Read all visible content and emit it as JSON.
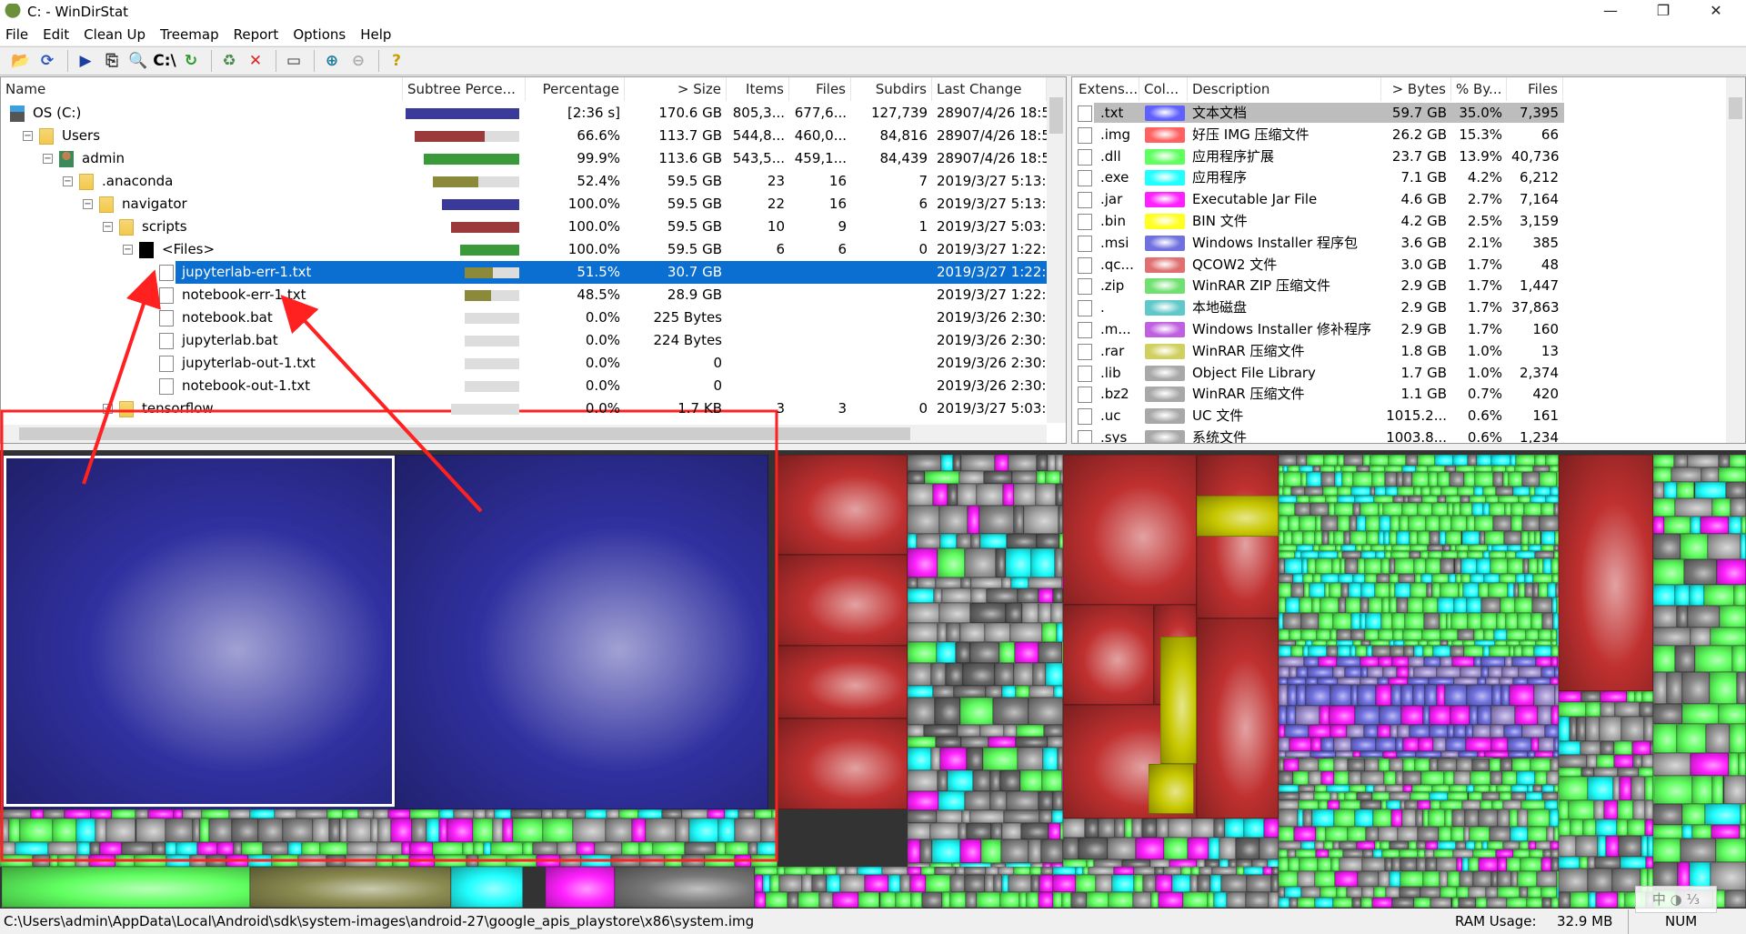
{
  "window": {
    "title": "C: - WinDirStat",
    "minimize": "—",
    "restore": "❐",
    "close": "✕"
  },
  "menu": [
    "File",
    "Edit",
    "Clean Up",
    "Treemap",
    "Report",
    "Options",
    "Help"
  ],
  "toolbar": [
    {
      "icon": "open-folder-icon",
      "glyph": "📂",
      "color": "#c89a1a"
    },
    {
      "icon": "refresh-all-icon",
      "glyph": "⟳",
      "color": "#2a55c0"
    },
    {
      "sep": true
    },
    {
      "icon": "play-icon",
      "glyph": "▶",
      "color": "#1b3fa0"
    },
    {
      "icon": "copy-path-icon",
      "glyph": "⎘",
      "color": "#333"
    },
    {
      "icon": "explorer-icon",
      "glyph": "🔍",
      "color": "#333"
    },
    {
      "icon": "command-prompt-icon",
      "glyph": "C:\\",
      "color": "#000"
    },
    {
      "icon": "refresh-selected-icon",
      "glyph": "↻",
      "color": "#2a9a2a"
    },
    {
      "sep": true
    },
    {
      "icon": "recycle-bin-icon",
      "glyph": "♻",
      "color": "#4a8a4a"
    },
    {
      "icon": "delete-icon",
      "glyph": "✕",
      "color": "#e02020"
    },
    {
      "sep": true
    },
    {
      "icon": "properties-icon",
      "glyph": "▭",
      "color": "#333"
    },
    {
      "sep": true
    },
    {
      "icon": "zoom-in-icon",
      "glyph": "⊕",
      "color": "#1a7a9a"
    },
    {
      "icon": "zoom-out-icon",
      "glyph": "⊖",
      "color": "#aaa"
    },
    {
      "sep": true
    },
    {
      "icon": "help-icon",
      "glyph": "?",
      "color": "#c8a000"
    }
  ],
  "tree": {
    "columns": [
      "Name",
      "Subtree Perce...",
      "Percentage",
      "> Size",
      "Items",
      "Files",
      "Subdirs",
      "Last Change"
    ],
    "rows": [
      {
        "name": "OS (C:)",
        "depth": 0,
        "icon": "drive",
        "expander": "",
        "fill": 1.0,
        "color": "#3a3a9a",
        "pct": "[2:36 s]",
        "size": "170.6 GB",
        "items": "805,3...",
        "files": "677,6...",
        "subdirs": "127,739",
        "changed": "28907/4/26  18:5"
      },
      {
        "name": "Users",
        "depth": 1,
        "icon": "folder",
        "expander": "−",
        "fill": 0.666,
        "color": "#9a3a3a",
        "pct": "66.6%",
        "size": "113.7 GB",
        "items": "544,8...",
        "files": "460,0...",
        "subdirs": "84,816",
        "changed": "28907/4/26  18:5"
      },
      {
        "name": "admin",
        "depth": 2,
        "icon": "user",
        "expander": "−",
        "fill": 0.999,
        "color": "#3a9a3a",
        "pct": "99.9%",
        "size": "113.6 GB",
        "items": "543,5...",
        "files": "459,1...",
        "subdirs": "84,439",
        "changed": "28907/4/26  18:5"
      },
      {
        "name": ".anaconda",
        "depth": 3,
        "icon": "folder",
        "expander": "−",
        "fill": 0.524,
        "color": "#8a8a3a",
        "pct": "52.4%",
        "size": "59.5 GB",
        "items": "23",
        "files": "16",
        "subdirs": "7",
        "changed": "2019/3/27  5:13:4"
      },
      {
        "name": "navigator",
        "depth": 4,
        "icon": "folder",
        "expander": "−",
        "fill": 1.0,
        "color": "#3a3a9a",
        "pct": "100.0%",
        "size": "59.5 GB",
        "items": "22",
        "files": "16",
        "subdirs": "6",
        "changed": "2019/3/27  5:13:4"
      },
      {
        "name": "scripts",
        "depth": 5,
        "icon": "folder",
        "expander": "−",
        "fill": 1.0,
        "color": "#9a3a3a",
        "pct": "100.0%",
        "size": "59.5 GB",
        "items": "10",
        "files": "9",
        "subdirs": "1",
        "changed": "2019/3/27  5:03:3"
      },
      {
        "name": "<Files>",
        "depth": 6,
        "icon": "files",
        "expander": "−",
        "fill": 1.0,
        "color": "#3a9a3a",
        "pct": "100.0%",
        "size": "59.5 GB",
        "items": "6",
        "files": "6",
        "subdirs": "0",
        "changed": "2019/3/27  1:22:5"
      },
      {
        "name": "jupyterlab-err-1.txt",
        "depth": 7,
        "icon": "file",
        "expander": "",
        "fill": 0.515,
        "color": "#8a8a3a",
        "pct": "51.5%",
        "size": "30.7 GB",
        "items": "",
        "files": "",
        "subdirs": "",
        "changed": "2019/3/27  1:22:5",
        "selected": true
      },
      {
        "name": "notebook-err-1.txt",
        "depth": 7,
        "icon": "file",
        "expander": "",
        "fill": 0.485,
        "color": "#8a8a3a",
        "pct": "48.5%",
        "size": "28.9 GB",
        "items": "",
        "files": "",
        "subdirs": "",
        "changed": "2019/3/27  1:22:5"
      },
      {
        "name": "notebook.bat",
        "depth": 7,
        "icon": "bat",
        "expander": "",
        "fill": 0,
        "color": "#8a8a3a",
        "pct": "0.0%",
        "size": "225 Bytes",
        "items": "",
        "files": "",
        "subdirs": "",
        "changed": "2019/3/26  2:30:4"
      },
      {
        "name": "jupyterlab.bat",
        "depth": 7,
        "icon": "bat",
        "expander": "",
        "fill": 0,
        "color": "#8a8a3a",
        "pct": "0.0%",
        "size": "224 Bytes",
        "items": "",
        "files": "",
        "subdirs": "",
        "changed": "2019/3/26  2:30:3"
      },
      {
        "name": "jupyterlab-out-1.txt",
        "depth": 7,
        "icon": "file",
        "expander": "",
        "fill": 0,
        "color": "#8a8a3a",
        "pct": "0.0%",
        "size": "0",
        "items": "",
        "files": "",
        "subdirs": "",
        "changed": "2019/3/26  2:30:3"
      },
      {
        "name": "notebook-out-1.txt",
        "depth": 7,
        "icon": "file",
        "expander": "",
        "fill": 0,
        "color": "#8a8a3a",
        "pct": "0.0%",
        "size": "0",
        "items": "",
        "files": "",
        "subdirs": "",
        "changed": "2019/3/26  2:30:4"
      },
      {
        "name": "tensorflow",
        "depth": 5,
        "icon": "folder",
        "expander": "+",
        "fill": 0,
        "color": "#9a3a3a",
        "pct": "0.0%",
        "size": "1.7 KB",
        "items": "3",
        "files": "3",
        "subdirs": "0",
        "changed": "2019/3/27  5:03:3"
      }
    ]
  },
  "extensions": {
    "columns": [
      "Extens...",
      "Col...",
      "Description",
      "> Bytes",
      "% By...",
      "Files"
    ],
    "rows": [
      {
        "ext": ".txt",
        "color": "#6060ff",
        "desc": "文本文档",
        "bytes": "59.7 GB",
        "pct": "35.0%",
        "files": "7,395",
        "selected": true
      },
      {
        "ext": ".img",
        "color": "#ff6060",
        "desc": "好压 IMG 压缩文件",
        "bytes": "26.2 GB",
        "pct": "15.3%",
        "files": "66"
      },
      {
        "ext": ".dll",
        "color": "#60ff60",
        "desc": "应用程序扩展",
        "bytes": "23.7 GB",
        "pct": "13.9%",
        "files": "40,736"
      },
      {
        "ext": ".exe",
        "color": "#20ffff",
        "desc": "应用程序",
        "bytes": "7.1 GB",
        "pct": "4.2%",
        "files": "6,212"
      },
      {
        "ext": ".jar",
        "color": "#ff20ff",
        "desc": "Executable Jar File",
        "bytes": "4.6 GB",
        "pct": "2.7%",
        "files": "7,164"
      },
      {
        "ext": ".bin",
        "color": "#ffff20",
        "desc": "BIN 文件",
        "bytes": "4.2 GB",
        "pct": "2.5%",
        "files": "3,159"
      },
      {
        "ext": ".msi",
        "color": "#7070e0",
        "desc": "Windows Installer 程序包",
        "bytes": "3.6 GB",
        "pct": "2.1%",
        "files": "385"
      },
      {
        "ext": ".qc...",
        "color": "#e07070",
        "desc": "QCOW2 文件",
        "bytes": "3.0 GB",
        "pct": "1.7%",
        "files": "48"
      },
      {
        "ext": ".zip",
        "color": "#70e070",
        "desc": "WinRAR ZIP 压缩文件",
        "bytes": "2.9 GB",
        "pct": "1.7%",
        "files": "1,447"
      },
      {
        "ext": ".",
        "color": "#60c8c8",
        "desc": "本地磁盘",
        "bytes": "2.9 GB",
        "pct": "1.7%",
        "files": "37,863"
      },
      {
        "ext": ".m...",
        "color": "#c060e0",
        "desc": "Windows Installer 修补程序",
        "bytes": "2.9 GB",
        "pct": "1.7%",
        "files": "160"
      },
      {
        "ext": ".rar",
        "color": "#d0d060",
        "desc": "WinRAR 压缩文件",
        "bytes": "1.8 GB",
        "pct": "1.0%",
        "files": "13"
      },
      {
        "ext": ".lib",
        "color": "#a8a8a8",
        "desc": "Object File Library",
        "bytes": "1.7 GB",
        "pct": "1.0%",
        "files": "2,374"
      },
      {
        "ext": ".bz2",
        "color": "#a8a8a8",
        "desc": "WinRAR 压缩文件",
        "bytes": "1.1 GB",
        "pct": "0.7%",
        "files": "420"
      },
      {
        "ext": ".uc",
        "color": "#a8a8a8",
        "desc": "UC 文件",
        "bytes": "1015.2...",
        "pct": "0.6%",
        "files": "161"
      },
      {
        "ext": ".sys",
        "color": "#a8a8a8",
        "desc": "系统文件",
        "bytes": "1003.8...",
        "pct": "0.6%",
        "files": "1,234"
      }
    ]
  },
  "status": {
    "path": "C:\\Users\\admin\\AppData\\Local\\Android\\sdk\\system-images\\android-27\\google_apis_playstore\\x86\\system.img",
    "ram_label": "RAM Usage:",
    "ram_value": "32.9 MB",
    "num": "NUM"
  },
  "ime": {
    "label": "中 ◑ ⅓"
  },
  "annotation_color": "#ff2020"
}
